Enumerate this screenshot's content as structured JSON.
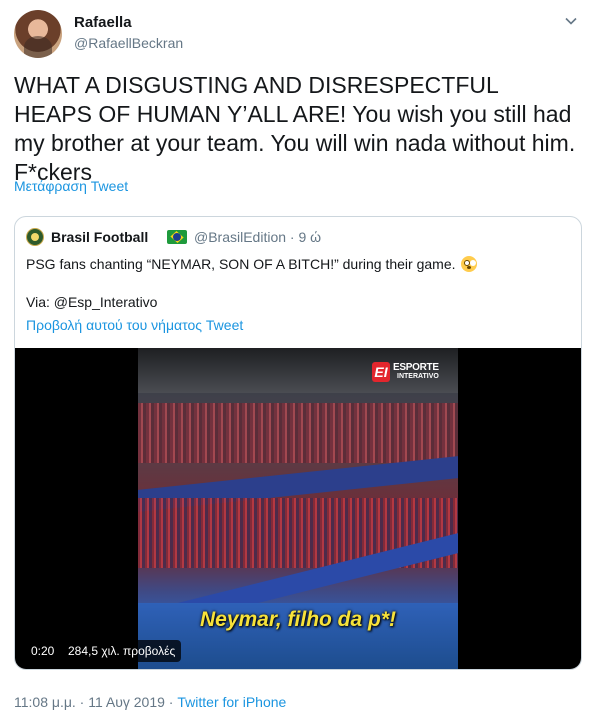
{
  "tweet": {
    "display_name": "Rafaella",
    "handle": "@RafaellBeckran",
    "text": "WHAT A DISGUSTING AND DISRESPECTFUL HEAPS OF HUMAN Y’ALL ARE! You wish you still had my brother at your team. You will win nada without him. F*ckers",
    "translate_label": "Μετάφραση Tweet",
    "timestamp": "11:08 μ.μ. · 11 Αυγ 2019",
    "separator": " · ",
    "source": "Twitter for iPhone"
  },
  "quoted": {
    "display_name": "Brasil Football",
    "flag_icon": "brazil-flag-icon",
    "handle_time": "@BrasilEdition · 9 ώ",
    "text": "PSG fans chanting “NEYMAR, SON OF A BITCH!” during their game.",
    "emoji_icon": "flushed-face-icon",
    "via": "Via: @Esp_Interativo",
    "thread_link": "Προβολή αυτού του νήματος Tweet"
  },
  "video": {
    "logo_line1": "ESPORTE",
    "logo_line2": "INTERATIVO",
    "caption": "Neymar, filho da p*!",
    "duration": "0:20",
    "views": "284,5 χιλ. προβολές"
  },
  "colors": {
    "link": "#1b95e0",
    "secondary_text": "#657786",
    "border": "#ccd6dd"
  }
}
